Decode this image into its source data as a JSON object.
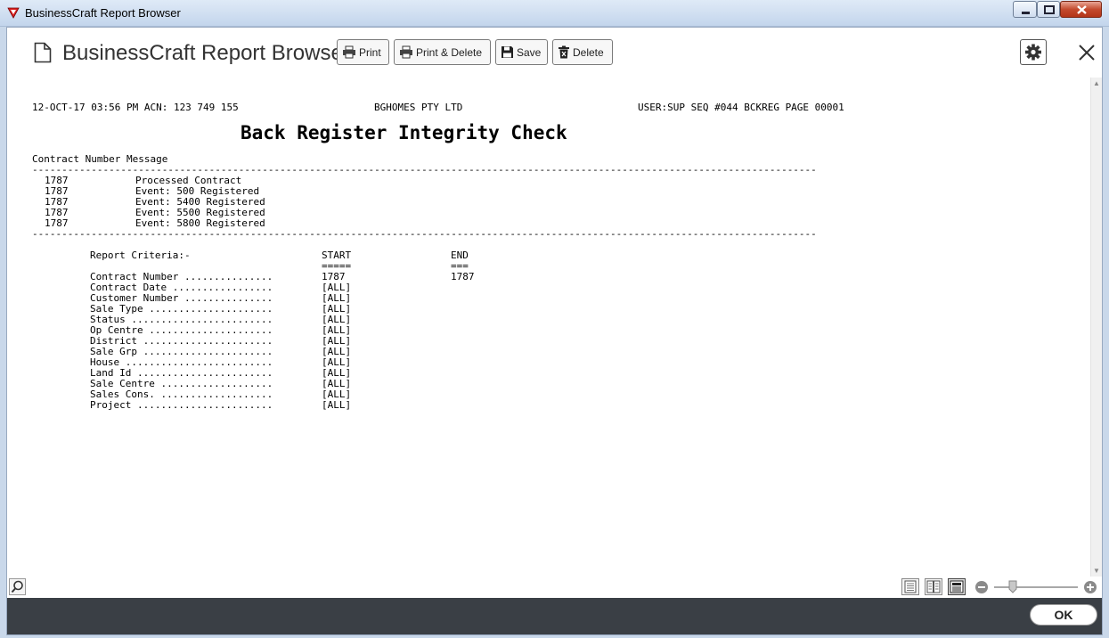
{
  "window": {
    "title": "BusinessCraft Report Browser"
  },
  "toolbar": {
    "app_title": "BusinessCraft Report Browser",
    "print_label": "Print",
    "print_delete_label": "Print & Delete",
    "save_label": "Save",
    "delete_label": "Delete"
  },
  "report": {
    "header_left": "12-OCT-17 03:56 PM ACN: 123 749 155",
    "header_center": "BGHOMES PTY LTD",
    "header_right": "USER:SUP SEQ #044 BCKREG PAGE 00001",
    "title": "Back Register Integrity Check",
    "column_header": "Contract Number Message",
    "separator": "-------------------------------------------------------------------------------------------------------------------------------------",
    "rows": [
      {
        "contract": "1787",
        "message": "Processed Contract"
      },
      {
        "contract": "1787",
        "message": "Event: 500 Registered"
      },
      {
        "contract": "1787",
        "message": "Event: 5400 Registered"
      },
      {
        "contract": "1787",
        "message": "Event: 5500 Registered"
      },
      {
        "contract": "1787",
        "message": "Event: 5800 Registered"
      }
    ],
    "criteria_label": "Report Criteria:-",
    "start_label": "START",
    "start_underline": "=====",
    "end_label": "END",
    "end_underline": "===",
    "criteria": [
      {
        "label": "Contract Number ...............",
        "start": "1787",
        "end": "1787"
      },
      {
        "label": "Contract Date .................",
        "start": "[ALL]",
        "end": ""
      },
      {
        "label": "Customer Number ...............",
        "start": "[ALL]",
        "end": ""
      },
      {
        "label": "Sale Type .....................",
        "start": "[ALL]",
        "end": ""
      },
      {
        "label": "Status ........................",
        "start": "[ALL]",
        "end": ""
      },
      {
        "label": "Op Centre .....................",
        "start": "[ALL]",
        "end": ""
      },
      {
        "label": "District ......................",
        "start": "[ALL]",
        "end": ""
      },
      {
        "label": "Sale Grp ......................",
        "start": "[ALL]",
        "end": ""
      },
      {
        "label": "House .........................",
        "start": "[ALL]",
        "end": ""
      },
      {
        "label": "Land Id .......................",
        "start": "[ALL]",
        "end": ""
      },
      {
        "label": "Sale Centre ...................",
        "start": "[ALL]",
        "end": ""
      },
      {
        "label": "Sales Cons. ...................",
        "start": "[ALL]",
        "end": ""
      },
      {
        "label": "Project .......................",
        "start": "[ALL]",
        "end": ""
      }
    ]
  },
  "footer": {
    "ok_label": "OK"
  },
  "icons": {
    "title": "businesscraft-logo-icon",
    "document": "document-icon",
    "print": "printer-icon",
    "save": "floppy-disk-icon",
    "delete": "trash-icon",
    "settings": "gear-icon",
    "close": "close-icon",
    "search": "magnifier-icon",
    "zoom_out": "minus-circle-icon",
    "zoom_in": "plus-circle-icon"
  },
  "colors": {
    "footer_bg": "#3a3f45",
    "titlebar_bg": "#c3d5ec",
    "close_button": "#c44a2e"
  }
}
